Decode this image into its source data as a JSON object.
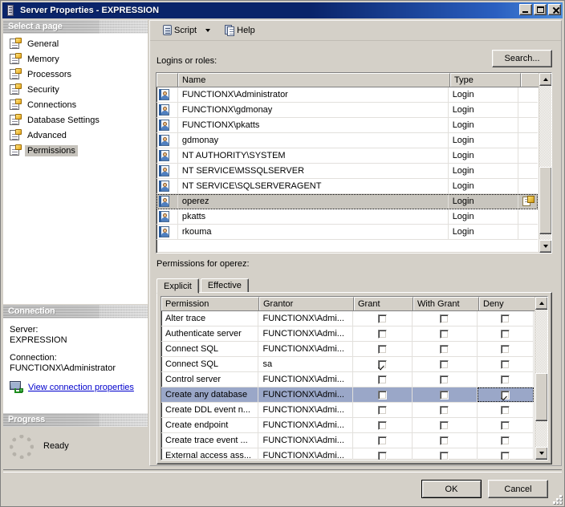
{
  "window": {
    "title": "Server Properties - EXPRESSION",
    "icon": "server-icon",
    "minimize": "_",
    "maximize": "□",
    "close": "×"
  },
  "toolbar": {
    "script_label": "Script",
    "script_icon": "script-icon",
    "dropdown_icon": "chevron-down-icon",
    "help_label": "Help",
    "help_icon": "help-icon"
  },
  "sidebar": {
    "header": "Select a page",
    "items": [
      {
        "label": "General",
        "selected": false
      },
      {
        "label": "Memory",
        "selected": false
      },
      {
        "label": "Processors",
        "selected": false
      },
      {
        "label": "Security",
        "selected": false
      },
      {
        "label": "Connections",
        "selected": false
      },
      {
        "label": "Database Settings",
        "selected": false
      },
      {
        "label": "Advanced",
        "selected": false
      },
      {
        "label": "Permissions",
        "selected": true
      }
    ]
  },
  "connection": {
    "header": "Connection",
    "server_label": "Server:",
    "server_value": "EXPRESSION",
    "connection_label": "Connection:",
    "connection_value": "FUNCTIONX\\Administrator",
    "link_text": "View connection properties",
    "link_icon": "connection-properties-icon"
  },
  "progress": {
    "header": "Progress",
    "status": "Ready",
    "spinner_icon": "progress-spinner-icon"
  },
  "logins": {
    "label": "Logins or roles:",
    "search_button": "Search...",
    "columns": [
      "",
      "Name",
      "Type",
      ""
    ],
    "rows": [
      {
        "icon": "login-icon",
        "name": "FUNCTIONX\\Administrator",
        "type": "Login",
        "selected": false,
        "action_icon": ""
      },
      {
        "icon": "login-icon",
        "name": "FUNCTIONX\\gdmonay",
        "type": "Login",
        "selected": false,
        "action_icon": ""
      },
      {
        "icon": "login-icon",
        "name": "FUNCTIONX\\pkatts",
        "type": "Login",
        "selected": false,
        "action_icon": ""
      },
      {
        "icon": "login-icon",
        "name": "gdmonay",
        "type": "Login",
        "selected": false,
        "action_icon": ""
      },
      {
        "icon": "login-icon",
        "name": "NT AUTHORITY\\SYSTEM",
        "type": "Login",
        "selected": false,
        "action_icon": ""
      },
      {
        "icon": "login-icon",
        "name": "NT SERVICE\\MSSQLSERVER",
        "type": "Login",
        "selected": false,
        "action_icon": ""
      },
      {
        "icon": "login-icon",
        "name": "NT SERVICE\\SQLSERVERAGENT",
        "type": "Login",
        "selected": false,
        "action_icon": ""
      },
      {
        "icon": "login-icon",
        "name": "operez",
        "type": "Login",
        "selected": true,
        "action_icon": "edit-icon"
      },
      {
        "icon": "login-icon",
        "name": "pkatts",
        "type": "Login",
        "selected": false,
        "action_icon": ""
      },
      {
        "icon": "login-icon",
        "name": "rkouma",
        "type": "Login",
        "selected": false,
        "action_icon": ""
      }
    ]
  },
  "permissions": {
    "label": "Permissions for operez:",
    "tabs": [
      {
        "label": "Explicit",
        "active": true
      },
      {
        "label": "Effective",
        "active": false
      }
    ],
    "columns": [
      "Permission",
      "Grantor",
      "Grant",
      "With Grant",
      "Deny"
    ],
    "rows": [
      {
        "permission": "Alter trace",
        "grantor": "FUNCTIONX\\Admi...",
        "grant": false,
        "with_grant": false,
        "deny": false,
        "selected": false
      },
      {
        "permission": "Authenticate server",
        "grantor": "FUNCTIONX\\Admi...",
        "grant": false,
        "with_grant": false,
        "deny": false,
        "selected": false
      },
      {
        "permission": "Connect SQL",
        "grantor": "FUNCTIONX\\Admi...",
        "grant": false,
        "with_grant": false,
        "deny": false,
        "selected": false
      },
      {
        "permission": "Connect SQL",
        "grantor": "sa",
        "grant": true,
        "with_grant": false,
        "deny": false,
        "selected": false
      },
      {
        "permission": "Control server",
        "grantor": "FUNCTIONX\\Admi...",
        "grant": false,
        "with_grant": false,
        "deny": false,
        "selected": false
      },
      {
        "permission": "Create any database",
        "grantor": "FUNCTIONX\\Admi...",
        "grant": false,
        "with_grant": false,
        "deny": true,
        "selected": true
      },
      {
        "permission": "Create DDL event n...",
        "grantor": "FUNCTIONX\\Admi...",
        "grant": false,
        "with_grant": false,
        "deny": false,
        "selected": false
      },
      {
        "permission": "Create endpoint",
        "grantor": "FUNCTIONX\\Admi...",
        "grant": false,
        "with_grant": false,
        "deny": false,
        "selected": false
      },
      {
        "permission": "Create trace event ...",
        "grantor": "FUNCTIONX\\Admi...",
        "grant": false,
        "with_grant": false,
        "deny": false,
        "selected": false
      },
      {
        "permission": "External access ass...",
        "grantor": "FUNCTIONX\\Admi...",
        "grant": false,
        "with_grant": false,
        "deny": false,
        "selected": false
      }
    ]
  },
  "footer": {
    "ok": "OK",
    "cancel": "Cancel"
  },
  "colors": {
    "titlebar": "#0a246a",
    "face": "#d4d0c8",
    "selection_blue": "#9aa7c8",
    "selection_gray": "#c8c5be",
    "link": "#0000cc"
  }
}
